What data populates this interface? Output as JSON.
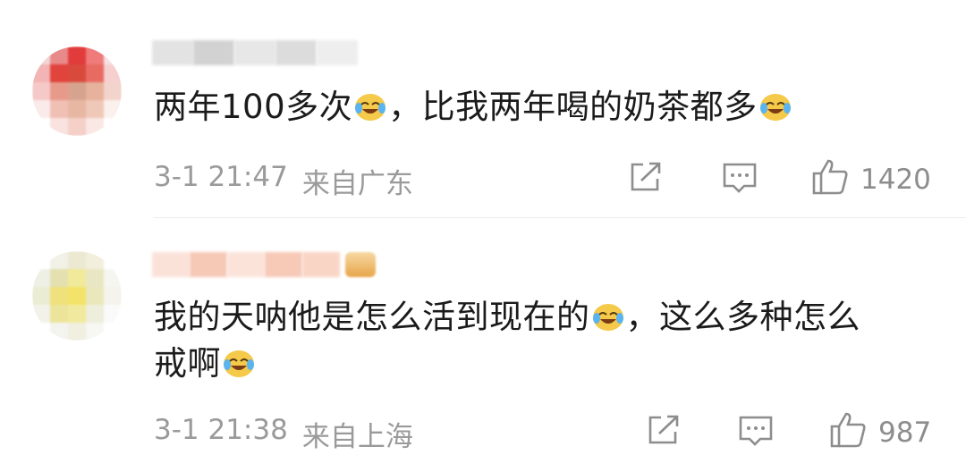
{
  "comments": [
    {
      "text_parts": [
        "两年100多次",
        "，比我两年喝的奶茶都多",
        ""
      ],
      "emoji_name": "laugh-cry-emoji",
      "time": "3-1 21:47",
      "location": "来自广东",
      "likes": "1420",
      "avatar_colors": [
        "#f4d6d6",
        "#e88a8a",
        "#e23b3b",
        "#ef7b7b",
        "#f7e3e3",
        "#f2b4b4",
        "#e0443c",
        "#d94a3c",
        "#e86b62",
        "#f6cfcf",
        "#f6c9c9",
        "#e79a8a",
        "#d6a48e",
        "#e7b29c",
        "#f3d4cc",
        "#fbeaea",
        "#f0c0b4",
        "#e8b7a4",
        "#efc8b8",
        "#faf0ec",
        "#ffffff",
        "#f8e3e0",
        "#f4d0c8",
        "#f9e8e4",
        "#ffffff"
      ]
    },
    {
      "text_parts": [
        "我的天呐他是怎么活到现在的",
        "，这么多种怎么",
        "戒啊"
      ],
      "emoji_name": "laugh-cry-emoji",
      "time": "3-1 21:38",
      "location": "来自上海",
      "likes": "987",
      "avatar_colors": [
        "#ffffff",
        "#f1f1e8",
        "#ece9d2",
        "#f2efdd",
        "#ffffff",
        "#eef0e6",
        "#e4e0b0",
        "#f0ea9a",
        "#e9e6c4",
        "#f6f6f0",
        "#eaecd4",
        "#efe27c",
        "#f3e36a",
        "#ebe7bd",
        "#f4f4ec",
        "#f2f2ea",
        "#ece49a",
        "#f1ea9e",
        "#eeeedc",
        "#fafafa",
        "#ffffff",
        "#f4f4ef",
        "#f0efe0",
        "#f7f7f3",
        "#ffffff"
      ]
    }
  ],
  "colors": {
    "meta": "#9a9a9a",
    "icon": "#8d8d8d",
    "divider": "#ececec"
  },
  "icons": [
    "share-icon",
    "reply-icon",
    "like-icon"
  ]
}
